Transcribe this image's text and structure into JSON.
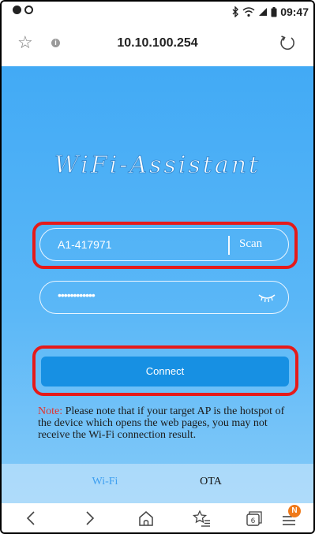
{
  "status_bar": {
    "time": "09:47",
    "left_icons": [
      "notification-dot-icon",
      "notification-dot-icon"
    ],
    "right_icons": [
      "bluetooth-icon",
      "wifi-icon",
      "signal-icon",
      "battery-icon"
    ]
  },
  "browser": {
    "url": "10.10.100.254"
  },
  "app": {
    "title": "WiFi-Assistant",
    "ssid_value": "A1-417971",
    "scan_label": "Scan",
    "password_value": "••••••••••••",
    "connect_label": "Connect",
    "note_label": "Note:",
    "note_text": " Please note that if your target AP is the hotspot of the device which opens the web pages, you may not receive the Wi-Fi connection result.",
    "tabs": [
      {
        "label": "Wi-Fi",
        "active": true
      },
      {
        "label": "OTA",
        "active": false
      }
    ]
  },
  "bottom_nav": {
    "tab_count": "6",
    "menu_badge": "N"
  },
  "colors": {
    "background_top": "#42aaf5",
    "connect_button": "#1790e3",
    "highlight": "#e51a1a",
    "note_label": "#e3332e",
    "active_tab": "#3e9ff0",
    "badge": "#f07a1a"
  }
}
